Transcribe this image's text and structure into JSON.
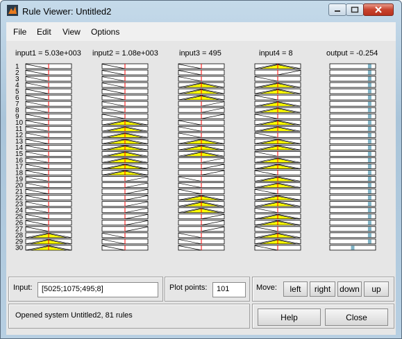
{
  "window": {
    "title": "Rule Viewer: Untitled2"
  },
  "menu": [
    "File",
    "Edit",
    "View",
    "Options"
  ],
  "columns": [
    {
      "label": "input1 = 5.03e+003",
      "value_frac": 0.5
    },
    {
      "label": "input2 = 1.08e+003",
      "value_frac": 0.5
    },
    {
      "label": "input3 = 495",
      "value_frac": 0.5
    },
    {
      "label": "input4 = 8",
      "value_frac": 0.5
    },
    {
      "label": "output = -0.254"
    }
  ],
  "rule_numbers": [
    "1",
    "2",
    "3",
    "4",
    "5",
    "6",
    "7",
    "8",
    "9",
    "10",
    "11",
    "12",
    "13",
    "14",
    "15",
    "16",
    "17",
    "18",
    "19",
    "20",
    "21",
    "22",
    "23",
    "24",
    "25",
    "26",
    "27",
    "28",
    "29",
    "30"
  ],
  "rules": [
    {
      "mf": [
        "left",
        "left",
        "left",
        "mid"
      ],
      "out": 0.87,
      "k": 0.05
    },
    {
      "mf": [
        "left",
        "left",
        "left",
        "right"
      ],
      "out": 0.87,
      "k": 0.03
    },
    {
      "mf": [
        "left",
        "left",
        "left",
        "left"
      ],
      "out": 0.87,
      "k": 0.03
    },
    {
      "mf": [
        "left",
        "left",
        "mid",
        "mid"
      ],
      "out": 0.87,
      "k": 0.05
    },
    {
      "mf": [
        "left",
        "left",
        "mid",
        "mid"
      ],
      "out": 0.87,
      "k": 0.05
    },
    {
      "mf": [
        "left",
        "left",
        "mid",
        "left"
      ],
      "out": 0.87,
      "k": 0.03
    },
    {
      "mf": [
        "left",
        "left",
        "right",
        "mid"
      ],
      "out": 0.87,
      "k": 0.05
    },
    {
      "mf": [
        "left",
        "left",
        "right",
        "mid"
      ],
      "out": 0.87,
      "k": 0.05
    },
    {
      "mf": [
        "left",
        "left",
        "right",
        "left"
      ],
      "out": 0.87,
      "k": 0.03
    },
    {
      "mf": [
        "left",
        "mid",
        "left",
        "mid"
      ],
      "out": 0.87,
      "k": 0.05
    },
    {
      "mf": [
        "left",
        "mid",
        "left",
        "mid"
      ],
      "out": 0.87,
      "k": 0.05
    },
    {
      "mf": [
        "left",
        "mid",
        "left",
        "left"
      ],
      "out": 0.87,
      "k": 0.03
    },
    {
      "mf": [
        "left",
        "mid",
        "mid",
        "mid"
      ],
      "out": 0.87,
      "k": 0.05
    },
    {
      "mf": [
        "left",
        "mid",
        "mid",
        "mid"
      ],
      "out": 0.87,
      "k": 0.05
    },
    {
      "mf": [
        "left",
        "mid",
        "mid",
        "left"
      ],
      "out": 0.87,
      "k": 0.03
    },
    {
      "mf": [
        "left",
        "mid",
        "right",
        "mid"
      ],
      "out": 0.87,
      "k": 0.05
    },
    {
      "mf": [
        "left",
        "mid",
        "right",
        "mid"
      ],
      "out": 0.87,
      "k": 0.05
    },
    {
      "mf": [
        "left",
        "mid",
        "right",
        "left"
      ],
      "out": 0.87,
      "k": 0.03
    },
    {
      "mf": [
        "left",
        "right",
        "left",
        "mid"
      ],
      "out": 0.87,
      "k": 0.05
    },
    {
      "mf": [
        "left",
        "right",
        "left",
        "mid"
      ],
      "out": 0.87,
      "k": 0.05
    },
    {
      "mf": [
        "left",
        "right",
        "left",
        "left"
      ],
      "out": 0.87,
      "k": 0.03
    },
    {
      "mf": [
        "left",
        "right",
        "mid",
        "mid"
      ],
      "out": 0.87,
      "k": 0.05
    },
    {
      "mf": [
        "left",
        "right",
        "mid",
        "mid"
      ],
      "out": 0.87,
      "k": 0.05
    },
    {
      "mf": [
        "left",
        "right",
        "mid",
        "left"
      ],
      "out": 0.87,
      "k": 0.03
    },
    {
      "mf": [
        "left",
        "right",
        "right",
        "mid"
      ],
      "out": 0.87,
      "k": 0.05
    },
    {
      "mf": [
        "left",
        "right",
        "right",
        "mid"
      ],
      "out": 0.87,
      "k": 0.05
    },
    {
      "mf": [
        "left",
        "right",
        "right",
        "left"
      ],
      "out": 0.87,
      "k": 0.03
    },
    {
      "mf": [
        "mid",
        "left",
        "left",
        "mid"
      ],
      "out": 0.87,
      "k": 0.05
    },
    {
      "mf": [
        "mid",
        "left",
        "left",
        "mid"
      ],
      "out": 0.87,
      "k": 0.05
    },
    {
      "mf": [
        "mid",
        "left",
        "left",
        "left"
      ],
      "out": 0.5,
      "k": 0.05
    }
  ],
  "input_field": {
    "label": "Input:",
    "value": "[5025;1075;495;8]"
  },
  "plot_points": {
    "label": "Plot points:",
    "value": "101"
  },
  "move": {
    "label": "Move:",
    "left": "left",
    "right": "right",
    "down": "down",
    "up": "up"
  },
  "status": "Opened system Untitled2, 81 rules",
  "buttons": {
    "help": "Help",
    "close": "Close"
  },
  "colors": {
    "fill": "#ffff00",
    "marker": "#ff0000",
    "output": "#7fb3c6"
  }
}
